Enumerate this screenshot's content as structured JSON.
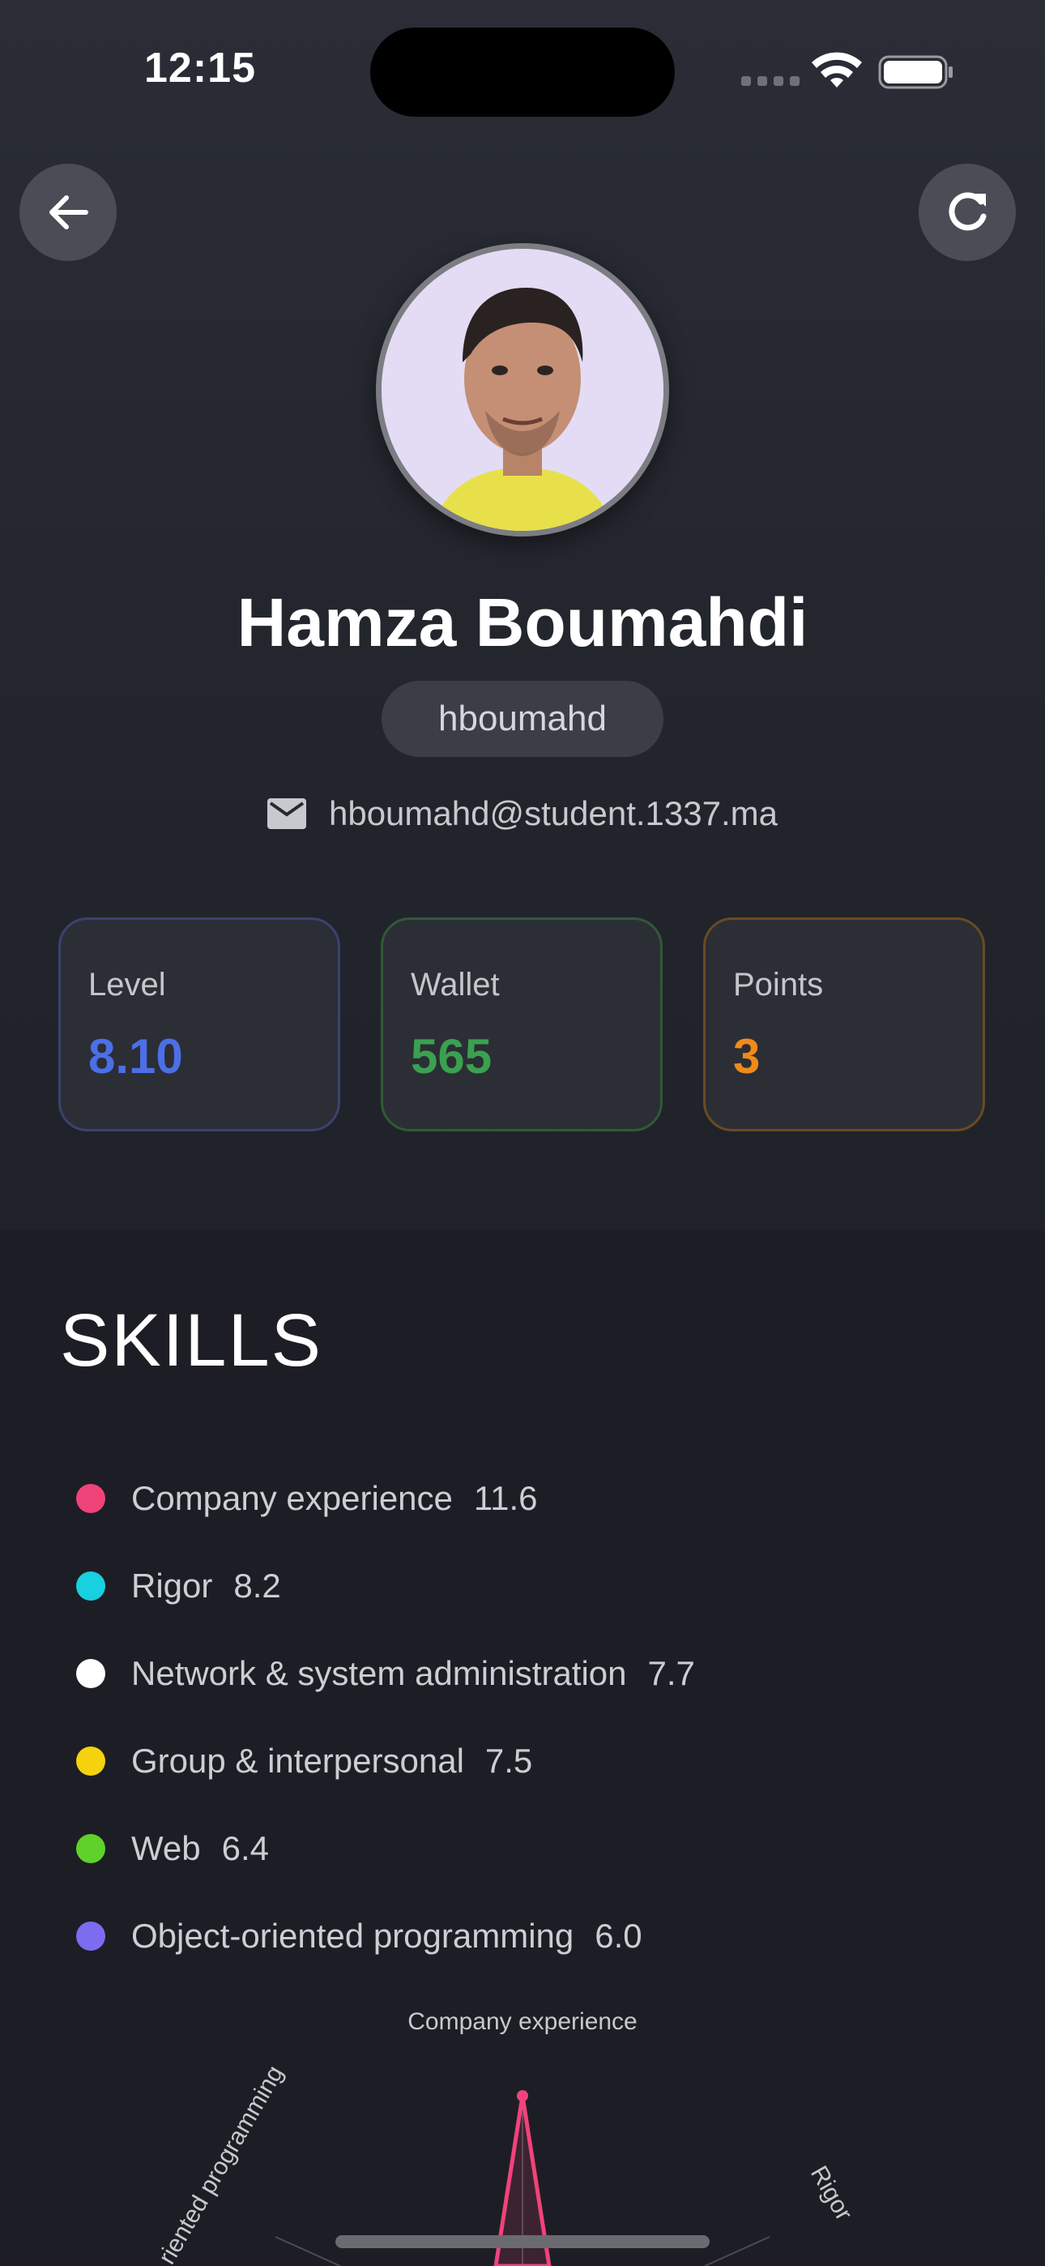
{
  "status_bar": {
    "time": "12:15"
  },
  "profile": {
    "name": "Hamza Boumahdi",
    "login": "hboumahd",
    "email": "hboumahd@student.1337.ma"
  },
  "stats": [
    {
      "label": "Level",
      "value": "8.10",
      "color": "#4c6fe6"
    },
    {
      "label": "Wallet",
      "value": "565",
      "color": "#3aa150"
    },
    {
      "label": "Points",
      "value": "3",
      "color": "#f08a1a"
    }
  ],
  "skills": {
    "title": "SKILLS",
    "items": [
      {
        "name": "Company experience",
        "value": "11.6",
        "color": "#f0437a"
      },
      {
        "name": "Rigor",
        "value": "8.2",
        "color": "#18d0e0"
      },
      {
        "name": "Network & system administration",
        "value": "7.7",
        "color": "#ffffff"
      },
      {
        "name": "Group & interpersonal",
        "value": "7.5",
        "color": "#f5d20e"
      },
      {
        "name": "Web",
        "value": "6.4",
        "color": "#5fd12a"
      },
      {
        "name": "Object-oriented programming",
        "value": "6.0",
        "color": "#7b6cf0"
      }
    ]
  },
  "radar": {
    "top_label": "Company experience",
    "left_label": "riented programming",
    "right_label": "Rigor"
  },
  "icons": {
    "back": "arrow-left-icon",
    "refresh": "refresh-icon",
    "email": "mail-icon"
  }
}
